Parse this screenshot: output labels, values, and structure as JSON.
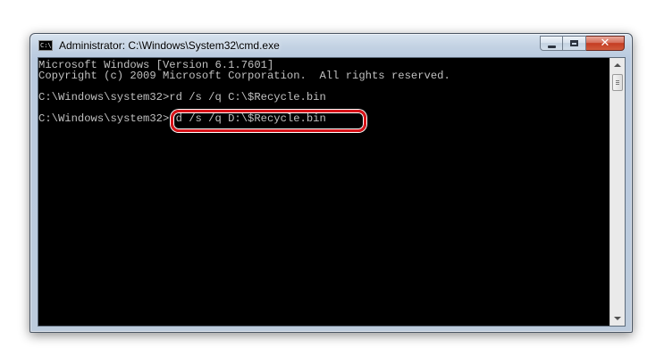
{
  "window": {
    "title": "Administrator: C:\\Windows\\System32\\cmd.exe",
    "icon": "cmd-icon",
    "icon_text": "C:\\",
    "controls": {
      "minimize": "minimize-icon",
      "maximize": "maximize-icon",
      "close": "close-icon",
      "close_glyph": "✕"
    }
  },
  "console": {
    "lines": [
      "Microsoft Windows [Version 6.1.7601]",
      "Copyright (c) 2009 Microsoft Corporation.  All rights reserved.",
      "",
      "C:\\Windows\\system32>rd /s /q C:\\$Recycle.bin",
      "",
      "C:\\Windows\\system32>rd /s /q D:\\$Recycle.bin"
    ],
    "highlighted_command": "rd /s /q D:\\$Recycle.bin",
    "text_color": "#c0c0c0",
    "background_color": "#000000",
    "highlight_color": "#d8141a"
  },
  "scrollbar": {
    "up_icon": "arrow-up-icon",
    "down_icon": "arrow-down-icon"
  }
}
